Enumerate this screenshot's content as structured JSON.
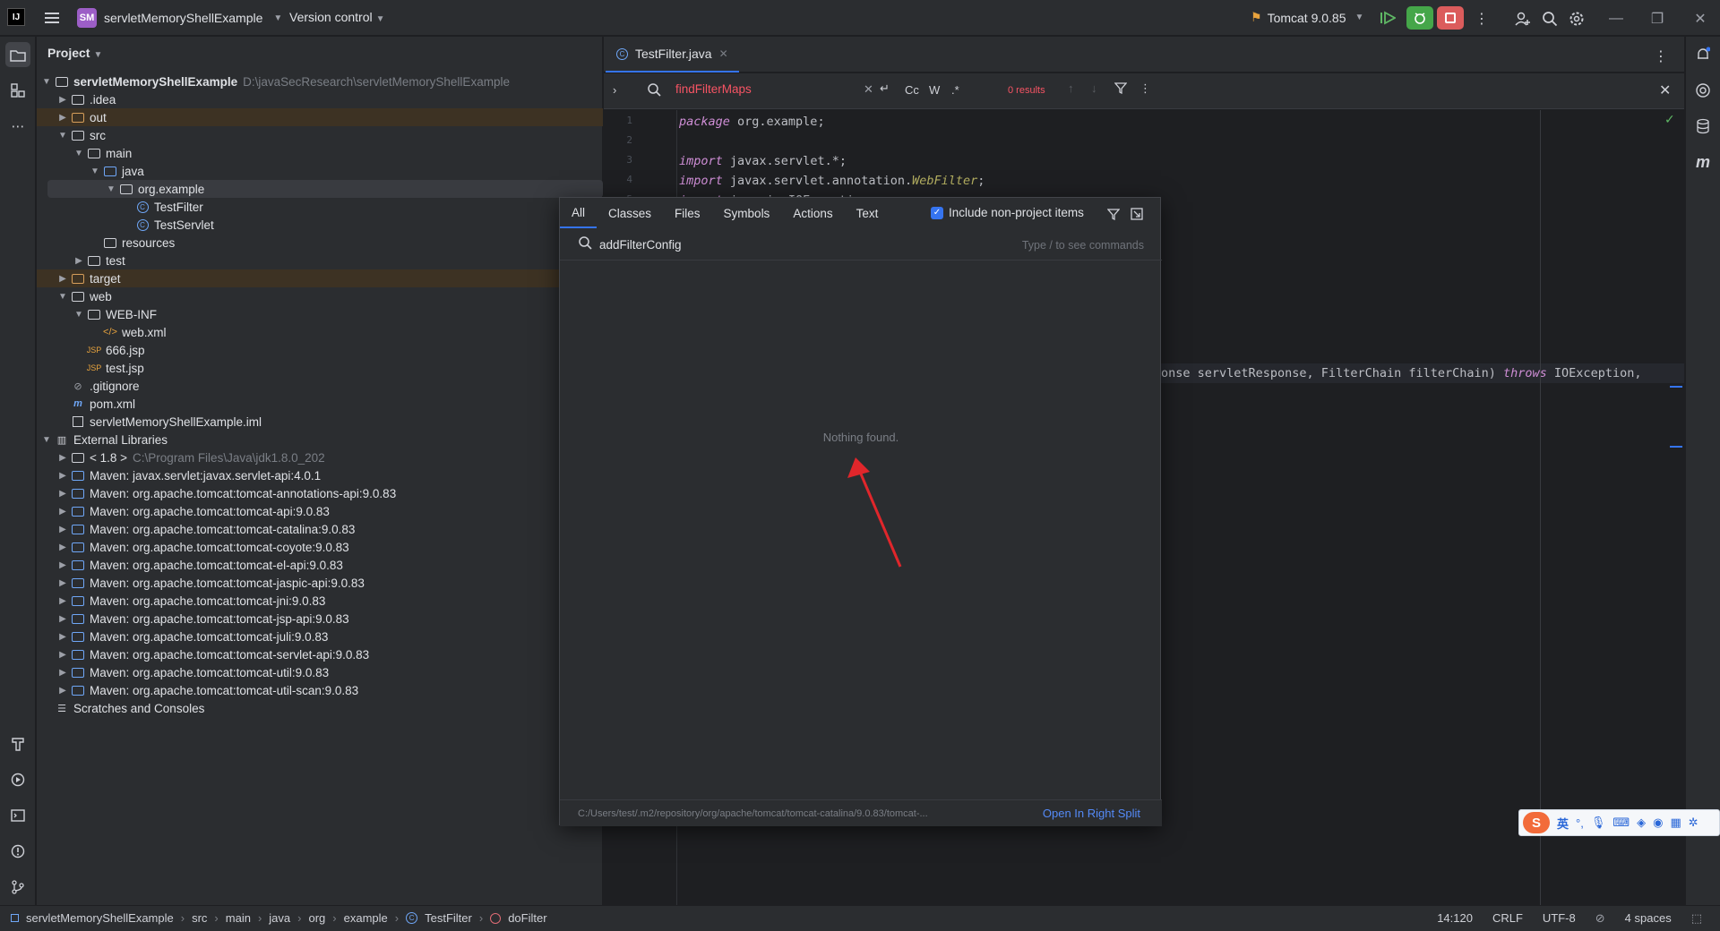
{
  "titlebar": {
    "project_initials": "SM",
    "project_name": "servletMemoryShellExample",
    "vcs_label": "Version control",
    "run_config": "Tomcat 9.0.85",
    "icons": [
      "app-logo-icon",
      "hamburger-icon",
      "run-icon",
      "debug-icon",
      "stop-icon",
      "more-icon",
      "add-user-icon",
      "search-icon",
      "gear-icon",
      "minimize-icon",
      "maximize-icon",
      "close-icon"
    ]
  },
  "project_panel": {
    "title": "Project",
    "tree": [
      {
        "name": "servletMemoryShellExample",
        "hint": "D:\\javaSecResearch\\servletMemoryShellExample",
        "bold": true
      },
      {
        "name": ".idea"
      },
      {
        "name": "out"
      },
      {
        "name": "src"
      },
      {
        "name": "main"
      },
      {
        "name": "java"
      },
      {
        "name": "org.example"
      },
      {
        "name": "TestFilter"
      },
      {
        "name": "TestServlet"
      },
      {
        "name": "resources"
      },
      {
        "name": "test"
      },
      {
        "name": "target"
      },
      {
        "name": "web"
      },
      {
        "name": "WEB-INF"
      },
      {
        "name": "web.xml"
      },
      {
        "name": "666.jsp"
      },
      {
        "name": "test.jsp"
      },
      {
        "name": ".gitignore"
      },
      {
        "name": "pom.xml"
      },
      {
        "name": "servletMemoryShellExample.iml"
      },
      {
        "name": "External Libraries"
      },
      {
        "name": "< 1.8 >",
        "hint": "C:\\Program Files\\Java\\jdk1.8.0_202"
      },
      {
        "name": "Maven: javax.servlet:javax.servlet-api:4.0.1"
      },
      {
        "name": "Maven: org.apache.tomcat:tomcat-annotations-api:9.0.83"
      },
      {
        "name": "Maven: org.apache.tomcat:tomcat-api:9.0.83"
      },
      {
        "name": "Maven: org.apache.tomcat:tomcat-catalina:9.0.83"
      },
      {
        "name": "Maven: org.apache.tomcat:tomcat-coyote:9.0.83"
      },
      {
        "name": "Maven: org.apache.tomcat:tomcat-el-api:9.0.83"
      },
      {
        "name": "Maven: org.apache.tomcat:tomcat-jaspic-api:9.0.83"
      },
      {
        "name": "Maven: org.apache.tomcat:tomcat-jni:9.0.83"
      },
      {
        "name": "Maven: org.apache.tomcat:tomcat-jsp-api:9.0.83"
      },
      {
        "name": "Maven: org.apache.tomcat:tomcat-juli:9.0.83"
      },
      {
        "name": "Maven: org.apache.tomcat:tomcat-servlet-api:9.0.83"
      },
      {
        "name": "Maven: org.apache.tomcat:tomcat-util:9.0.83"
      },
      {
        "name": "Maven: org.apache.tomcat:tomcat-util-scan:9.0.83"
      },
      {
        "name": "Scratches and Consoles"
      }
    ]
  },
  "editor": {
    "tab_label": "TestFilter.java",
    "find": {
      "query": "findFilterMaps",
      "results": "0 results",
      "case_label": "Cc",
      "word_label": "W",
      "regex_label": ".*"
    },
    "lines": [
      {
        "n": "1",
        "segments": [
          {
            "t": "package",
            "c": "kw"
          },
          {
            "t": " org.example;",
            "c": "type"
          }
        ]
      },
      {
        "n": "2",
        "segments": []
      },
      {
        "n": "3",
        "segments": [
          {
            "t": "import",
            "c": "kw"
          },
          {
            "t": " javax.servlet.*;",
            "c": "type"
          }
        ]
      },
      {
        "n": "4",
        "segments": [
          {
            "t": "import",
            "c": "kw"
          },
          {
            "t": " javax.servlet.annotation.",
            "c": "type"
          },
          {
            "t": "WebFilter",
            "c": "ann"
          },
          {
            "t": ";",
            "c": "type"
          }
        ]
      },
      {
        "n": "5",
        "segments": [
          {
            "t": "import",
            "c": "kw"
          },
          {
            "t": " java.io.IOException;",
            "c": "type"
          }
        ]
      }
    ],
    "partial_line": {
      "prefix": "onse servletResponse, FilterChain filterChain) ",
      "throws": "throws",
      "suffix": " IOException, "
    }
  },
  "search_popup": {
    "tabs": [
      "All",
      "Classes",
      "Files",
      "Symbols",
      "Actions",
      "Text"
    ],
    "include_label": "Include non-project items",
    "include_checked": true,
    "query": "addFilterConfig",
    "hint": "Type / to see commands",
    "empty_text": "Nothing found.",
    "footer_path": "C:/Users/test/.m2/repository/org/apache/tomcat/tomcat-catalina/9.0.83/tomcat-...",
    "footer_action": "Open In Right Split"
  },
  "statusbar": {
    "breadcrumbs": [
      "servletMemoryShellExample",
      "src",
      "main",
      "java",
      "org",
      "example",
      "TestFilter",
      "doFilter"
    ],
    "position": "14:120",
    "line_sep": "CRLF",
    "encoding": "UTF-8",
    "indent": "4 spaces"
  },
  "ime": {
    "mode_label": "英"
  },
  "colors": {
    "accent": "#3574f0",
    "error_text": "#f75464",
    "run_green": "#45a649",
    "stop_red": "#db5c5c",
    "excluded_bg": "#3d3223",
    "arrow_red": "#e0262b"
  }
}
